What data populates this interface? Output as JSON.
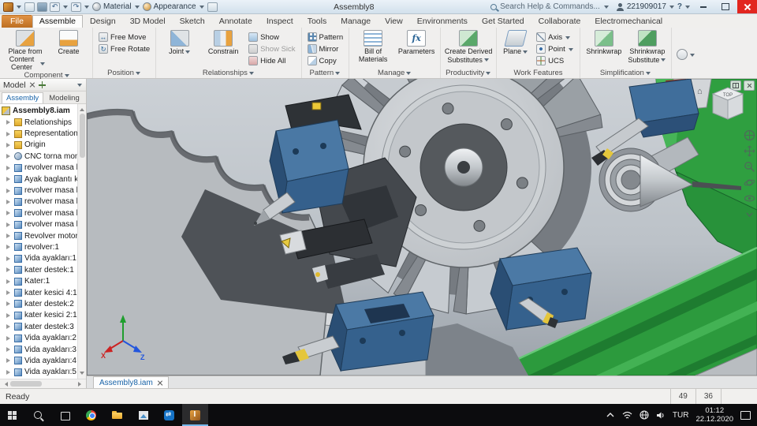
{
  "colors": {
    "accent_blue": "#1863a8",
    "file_tab_orange": "#bd6f23",
    "machine_green": "#2f9f40",
    "tool_steel_blue": "#3f6d99",
    "taskbar_black": "#0c0c0e"
  },
  "titlebar": {
    "material_label": "Material",
    "appearance_label": "Appearance",
    "doc_title": "Assembly8",
    "search_placeholder": "Search Help & Commands...",
    "user_id": "221909017",
    "help_label": "?"
  },
  "ribbon": {
    "tabs": [
      {
        "label": "File",
        "type": "file"
      },
      {
        "label": "Assemble",
        "active": true
      },
      {
        "label": "Design"
      },
      {
        "label": "3D Model"
      },
      {
        "label": "Sketch"
      },
      {
        "label": "Annotate"
      },
      {
        "label": "Inspect"
      },
      {
        "label": "Tools"
      },
      {
        "label": "Manage"
      },
      {
        "label": "View"
      },
      {
        "label": "Environments"
      },
      {
        "label": "Get Started"
      },
      {
        "label": "Collaborate"
      },
      {
        "label": "Electromechanical"
      }
    ],
    "panels": {
      "component": {
        "label": "Component",
        "place": [
          "Place from",
          "Content Center"
        ],
        "create": "Create"
      },
      "position": {
        "label": "Position",
        "free_move": "Free Move",
        "free_rotate": "Free Rotate"
      },
      "relationships": {
        "label": "Relationships",
        "joint": "Joint",
        "constrain": "Constrain",
        "show": "Show",
        "show_sick": "Show Sick",
        "hide_all": "Hide All"
      },
      "pattern": {
        "label": "Pattern",
        "pattern": "Pattern",
        "mirror": "Mirror",
        "copy": "Copy"
      },
      "manage": {
        "label": "Manage",
        "bom": [
          "Bill of",
          "Materials"
        ],
        "fx_glyph": "fx",
        "parameters": "Parameters"
      },
      "productivity": {
        "label": "Productivity",
        "derived": [
          "Create Derived",
          "Substitutes"
        ]
      },
      "work_features": {
        "label": "Work Features",
        "plane": "Plane",
        "axis": "Axis",
        "point": "Point",
        "ucs": "UCS"
      },
      "simplification": {
        "label": "Simplification",
        "shrinkwrap": "Shrinkwrap",
        "shrinkwrap_sub": [
          "Shrinkwrap",
          "Substitute"
        ]
      }
    }
  },
  "browser": {
    "panel_tab": "Model",
    "tabs": [
      {
        "label": "Assembly",
        "active": true
      },
      {
        "label": "Modeling"
      }
    ],
    "root": "Assembly8.iam",
    "tree": [
      {
        "icon": "folder",
        "label": "Relationships"
      },
      {
        "icon": "folder",
        "label": "Representations"
      },
      {
        "icon": "folder",
        "label": "Origin"
      },
      {
        "icon": "gear",
        "label": "CNC torna montaj:"
      },
      {
        "icon": "part",
        "label": "revolver masa hatt"
      },
      {
        "icon": "part",
        "label": "Ayak baglantı kayd"
      },
      {
        "icon": "part",
        "label": "revolver masa hatt"
      },
      {
        "icon": "part",
        "label": "revolver masa hatt"
      },
      {
        "icon": "part",
        "label": "revolver masa hatt"
      },
      {
        "icon": "part",
        "label": "revolver masa hatt"
      },
      {
        "icon": "part",
        "label": "Revolver motoru al"
      },
      {
        "icon": "part",
        "label": "revolver:1"
      },
      {
        "icon": "part",
        "label": "Vida ayakları:1"
      },
      {
        "icon": "part",
        "label": "kater destek:1"
      },
      {
        "icon": "part",
        "label": "Kater:1"
      },
      {
        "icon": "part",
        "label": "kater kesici 4:1"
      },
      {
        "icon": "part",
        "label": "kater destek:2"
      },
      {
        "icon": "part",
        "label": "kater kesici 2:1"
      },
      {
        "icon": "part",
        "label": "kater destek:3"
      },
      {
        "icon": "part",
        "label": "Vida ayakları:2"
      },
      {
        "icon": "part",
        "label": "Vida ayakları:3"
      },
      {
        "icon": "part",
        "label": "Vida ayakları:4"
      },
      {
        "icon": "part",
        "label": "Vida ayakları:5"
      }
    ]
  },
  "viewport": {
    "doc_tab": "Assembly8.iam",
    "viewcube_top_label": "TOP",
    "triad": {
      "x_label": "X",
      "z_label": "Z"
    }
  },
  "statusbar": {
    "message": "Ready",
    "value_1": "49",
    "value_2": "36"
  },
  "taskbar": {
    "apps": [
      {
        "icon": "start"
      },
      {
        "icon": "search"
      },
      {
        "icon": "taskview"
      },
      {
        "icon": "chrome"
      },
      {
        "icon": "explorer"
      },
      {
        "icon": "photos"
      },
      {
        "icon": "swap"
      },
      {
        "icon": "inventor",
        "active": true
      }
    ],
    "language": "TUR",
    "time": "01:12",
    "date": "22.12.2020"
  }
}
